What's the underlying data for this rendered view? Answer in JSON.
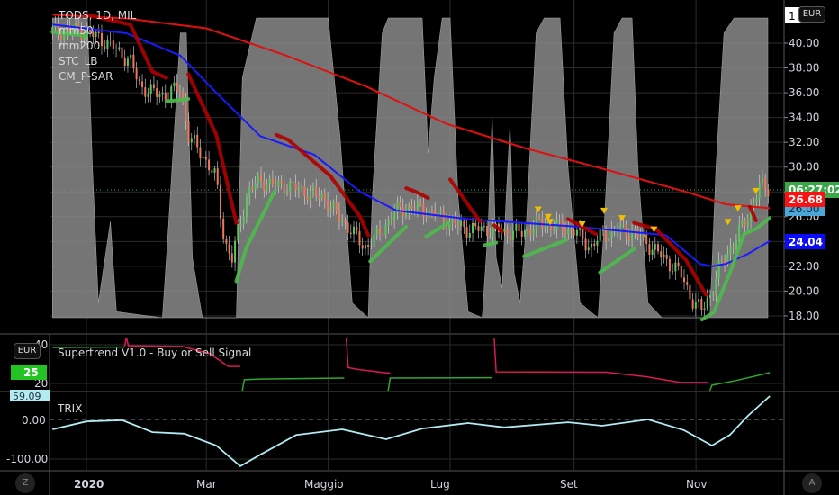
{
  "legend": {
    "symbol": "TODS, 1D, MIL",
    "ind1": "mm50",
    "ind2": "mm200",
    "ind3": "STC_LB",
    "ind4": "CM_P-SAR"
  },
  "panels": {
    "supertrend_title": "Supertrend V1.0 - Buy or Sell Signal",
    "trix_title": "TRIX"
  },
  "buttons": {
    "currency": "EUR",
    "currency_sub": "EUR",
    "z": "Z",
    "a": "A"
  },
  "price_axis": {
    "ticks": [
      "40.00",
      "38.00",
      "36.00",
      "34.00",
      "32.00",
      "30.00",
      "28.00",
      "26.00",
      "24.00",
      "22.00",
      "20.00",
      "18.00"
    ],
    "top_cut": "1"
  },
  "price_labels": {
    "countdown": "06:27:02",
    "mm200": "26.68",
    "stc": "26.00",
    "mm50": "24.04"
  },
  "st_axis": {
    "ticks": [
      "40",
      "20"
    ],
    "current": "25"
  },
  "trix_axis": {
    "ticks": [
      "0.00",
      "-100.00"
    ],
    "current": "59.09"
  },
  "time_axis": [
    "2020",
    "Mar",
    "Maggio",
    "Lug",
    "Set",
    "Nov"
  ],
  "colors": {
    "up": "#5cc85c",
    "down": "#f0785a",
    "mm50": "#1a1aff",
    "mm200": "#e01010",
    "sar_red": "#b00000",
    "sar_green": "#4cbb4c",
    "stc": "#8a8a8a",
    "trix": "#b2ebf2",
    "st_red": "#d81b50",
    "st_green": "#2fa82f",
    "marker": "#f0c000"
  },
  "chart_data": [
    {
      "type": "candlestick",
      "title": "TODS, 1D, MIL",
      "x_unit": "days since 2020-01-01",
      "ylim": [
        17.5,
        42.5
      ],
      "close_path": [
        [
          -17,
          41
        ],
        [
          -3,
          41
        ],
        [
          6,
          40.5
        ],
        [
          15,
          39.5
        ],
        [
          22,
          38.5
        ],
        [
          27,
          36.5
        ],
        [
          33,
          36
        ],
        [
          40,
          35.8
        ],
        [
          47,
          36.5
        ],
        [
          51,
          32.5
        ],
        [
          58,
          31
        ],
        [
          65,
          29
        ],
        [
          69,
          24
        ],
        [
          73,
          22.5
        ],
        [
          76,
          25
        ],
        [
          81,
          28
        ],
        [
          87,
          29
        ],
        [
          94,
          28.5
        ],
        [
          101,
          28.5
        ],
        [
          110,
          28
        ],
        [
          119,
          27.5
        ],
        [
          126,
          26
        ],
        [
          132,
          25
        ],
        [
          139,
          23.5
        ],
        [
          146,
          24.5
        ],
        [
          155,
          26.5
        ],
        [
          164,
          26.8
        ],
        [
          173,
          26.3
        ],
        [
          182,
          25.5
        ],
        [
          191,
          25
        ],
        [
          200,
          25
        ],
        [
          209,
          24.8
        ],
        [
          218,
          24.7
        ],
        [
          227,
          25.5
        ],
        [
          236,
          25.2
        ],
        [
          245,
          24.8
        ],
        [
          252,
          23.5
        ],
        [
          258,
          24.5
        ],
        [
          267,
          25
        ],
        [
          276,
          24.5
        ],
        [
          283,
          23.5
        ],
        [
          290,
          22.5
        ],
        [
          297,
          21.5
        ],
        [
          304,
          19
        ],
        [
          308,
          18.5
        ],
        [
          313,
          20
        ],
        [
          317,
          22
        ],
        [
          324,
          24
        ],
        [
          331,
          26
        ],
        [
          337,
          28.5
        ],
        [
          342,
          28.2
        ]
      ],
      "mm50": [
        [
          -17,
          41.5
        ],
        [
          20,
          40.8
        ],
        [
          47,
          39
        ],
        [
          65,
          36
        ],
        [
          87,
          32.5
        ],
        [
          114,
          31
        ],
        [
          137,
          28
        ],
        [
          155,
          26.5
        ],
        [
          191,
          25.8
        ],
        [
          245,
          25.2
        ],
        [
          290,
          24.5
        ],
        [
          307,
          22.2
        ],
        [
          313,
          22
        ],
        [
          320,
          22.2
        ],
        [
          331,
          23
        ],
        [
          342,
          24.04
        ]
      ],
      "mm200": [
        [
          -17,
          42.3
        ],
        [
          20,
          42
        ],
        [
          60,
          41.2
        ],
        [
          100,
          39
        ],
        [
          140,
          36.5
        ],
        [
          180,
          33.5
        ],
        [
          220,
          31.5
        ],
        [
          260,
          29.8
        ],
        [
          300,
          28
        ],
        [
          320,
          27
        ],
        [
          342,
          26.68
        ]
      ],
      "stc": [
        [
          -17,
          100
        ],
        [
          0.5,
          100
        ],
        [
          3,
          50
        ],
        [
          6,
          5
        ],
        [
          12,
          32
        ],
        [
          15,
          2
        ],
        [
          38,
          0
        ],
        [
          41,
          30
        ],
        [
          47,
          95
        ],
        [
          50,
          95
        ],
        [
          53,
          20
        ],
        [
          58,
          0
        ],
        [
          75,
          0
        ],
        [
          78,
          80
        ],
        [
          85,
          100
        ],
        [
          121,
          100
        ],
        [
          127,
          60
        ],
        [
          133,
          5
        ],
        [
          141,
          0
        ],
        [
          143,
          40
        ],
        [
          148,
          95
        ],
        [
          151,
          100
        ],
        [
          168,
          100
        ],
        [
          171,
          55
        ],
        [
          174,
          80
        ],
        [
          178,
          100
        ],
        [
          182,
          100
        ],
        [
          186,
          40
        ],
        [
          191,
          2
        ],
        [
          198,
          0
        ],
        [
          201,
          30
        ],
        [
          203,
          68
        ],
        [
          205,
          20
        ],
        [
          208,
          10
        ],
        [
          210,
          40
        ],
        [
          212,
          65
        ],
        [
          214,
          15
        ],
        [
          217,
          5
        ],
        [
          220,
          30
        ],
        [
          225,
          95
        ],
        [
          229,
          100
        ],
        [
          237,
          100
        ],
        [
          241,
          50
        ],
        [
          247,
          5
        ],
        [
          256,
          0
        ],
        [
          259,
          30
        ],
        [
          264,
          95
        ],
        [
          268,
          100
        ],
        [
          273,
          100
        ],
        [
          276,
          50
        ],
        [
          281,
          5
        ],
        [
          288,
          0
        ],
        [
          312,
          0
        ],
        [
          315,
          50
        ],
        [
          319,
          95
        ],
        [
          324,
          100
        ],
        [
          341,
          100
        ]
      ],
      "psar_segments": [
        {
          "c": "green",
          "p": [
            [
              -17,
              40.9
            ],
            [
              0,
              40.6
            ]
          ]
        },
        {
          "c": "red",
          "p": [
            [
              0,
              42.3
            ],
            [
              22,
              41.5
            ],
            [
              33,
              37.7
            ],
            [
              40,
              37.2
            ]
          ]
        },
        {
          "c": "green",
          "p": [
            [
              40,
              35.3
            ],
            [
              51,
              35.5
            ]
          ]
        },
        {
          "c": "red",
          "p": [
            [
              51,
              37.5
            ],
            [
              65,
              32.6
            ],
            [
              75,
              25.5
            ]
          ]
        },
        {
          "c": "green",
          "p": [
            [
              75,
              20.8
            ],
            [
              80,
              23.5
            ],
            [
              94,
              28
            ]
          ]
        },
        {
          "c": "red",
          "p": [
            [
              95,
              32.6
            ],
            [
              101,
              32.2
            ],
            [
              122,
              29.3
            ],
            [
              137,
              26
            ],
            [
              141,
              24.5
            ]
          ]
        },
        {
          "c": "green",
          "p": [
            [
              142,
              22.4
            ],
            [
              160,
              25.2
            ]
          ]
        },
        {
          "c": "red",
          "p": [
            [
              160,
              28.3
            ],
            [
              165,
              28
            ],
            [
              171,
              27.5
            ]
          ]
        },
        {
          "c": "green",
          "p": [
            [
              170,
              24.4
            ],
            [
              181,
              25.5
            ]
          ]
        },
        {
          "c": "red",
          "p": [
            [
              182,
              29
            ],
            [
              197,
              25.6
            ]
          ]
        },
        {
          "c": "green",
          "p": [
            [
              199,
              23.7
            ],
            [
              205,
              23.9
            ]
          ]
        },
        {
          "c": "red",
          "p": [
            [
              204,
              25.3
            ],
            [
              208,
              24.8
            ]
          ]
        },
        {
          "c": "green",
          "p": [
            [
              219,
              22.8
            ],
            [
              240,
              24.1
            ]
          ]
        },
        {
          "c": "red",
          "p": [
            [
              241,
              25.8
            ],
            [
              255,
              24.6
            ]
          ]
        },
        {
          "c": "green",
          "p": [
            [
              257,
              21.5
            ],
            [
              274,
              23.4
            ]
          ]
        },
        {
          "c": "red",
          "p": [
            [
              274,
              25.5
            ],
            [
              285,
              25
            ],
            [
              300,
              22.5
            ],
            [
              310,
              19.7
            ]
          ]
        },
        {
          "c": "green",
          "p": [
            [
              308,
              17.7
            ],
            [
              314,
              18.3
            ],
            [
              323,
              21.9
            ],
            [
              329,
              24.6
            ],
            [
              335,
              25
            ],
            [
              342,
              25.9
            ]
          ]
        },
        {
          "c": "red",
          "p": [
            [
              332,
              26.8
            ],
            [
              335,
              25.7
            ]
          ]
        }
      ],
      "sell_markers": [
        [
          226,
          25.8
        ],
        [
          231,
          25.2
        ],
        [
          232,
          24.8
        ],
        [
          248,
          24.6
        ],
        [
          259,
          25.7
        ],
        [
          268,
          25.1
        ],
        [
          284,
          24.2
        ],
        [
          321,
          24.8
        ],
        [
          326,
          25.9
        ],
        [
          335,
          27.3
        ]
      ]
    },
    {
      "type": "line",
      "title": "Supertrend V1.0 - Buy or Sell Signal",
      "ylim": [
        15,
        42
      ],
      "segments": [
        {
          "c": "green",
          "p": [
            [
              -17,
              38.6
            ],
            [
              19,
              38.8
            ]
          ]
        },
        {
          "c": "red",
          "p": [
            [
              19,
              38.8
            ],
            [
              20,
              43.7
            ],
            [
              21,
              39.5
            ],
            [
              48,
              39.1
            ],
            [
              62,
              35.3
            ],
            [
              71,
              28.8
            ],
            [
              77,
              28.8
            ]
          ]
        },
        {
          "c": "green",
          "p": [
            [
              78,
              16.3
            ],
            [
              79,
              21.9
            ],
            [
              87,
              22.3
            ],
            [
              129,
              22.8
            ]
          ]
        },
        {
          "c": "red",
          "p": [
            [
              130,
              43.7
            ],
            [
              131,
              28.2
            ],
            [
              135,
              27.4
            ],
            [
              150,
              25.5
            ],
            [
              152,
              25.5
            ]
          ]
        },
        {
          "c": "green",
          "p": [
            [
              151,
              16.3
            ],
            [
              152,
              22.8
            ],
            [
              203,
              23.0
            ]
          ]
        },
        {
          "c": "red",
          "p": [
            [
              204,
              43.7
            ],
            [
              205,
              26.0
            ],
            [
              260,
              25.8
            ],
            [
              280,
              23.5
            ],
            [
              297,
              20.5
            ],
            [
              311,
              20.5
            ]
          ]
        },
        {
          "c": "green",
          "p": [
            [
              312,
              16.3
            ],
            [
              313,
              19.1
            ],
            [
              325,
              21.5
            ],
            [
              342,
              25.6
            ]
          ]
        }
      ]
    },
    {
      "type": "line",
      "title": "TRIX",
      "ylim": [
        -125,
        60
      ],
      "points": [
        [
          -17,
          -25
        ],
        [
          0,
          -5
        ],
        [
          18,
          -2
        ],
        [
          33,
          -32
        ],
        [
          49,
          -36
        ],
        [
          65,
          -66
        ],
        [
          77,
          -118
        ],
        [
          87,
          -89
        ],
        [
          105,
          -39
        ],
        [
          128,
          -25
        ],
        [
          150,
          -50
        ],
        [
          168,
          -23
        ],
        [
          191,
          -9
        ],
        [
          209,
          -20
        ],
        [
          241,
          -7
        ],
        [
          258,
          -16
        ],
        [
          281,
          0
        ],
        [
          299,
          -27
        ],
        [
          313,
          -66
        ],
        [
          322,
          -39
        ],
        [
          331,
          9
        ],
        [
          342,
          59.09
        ]
      ]
    }
  ]
}
